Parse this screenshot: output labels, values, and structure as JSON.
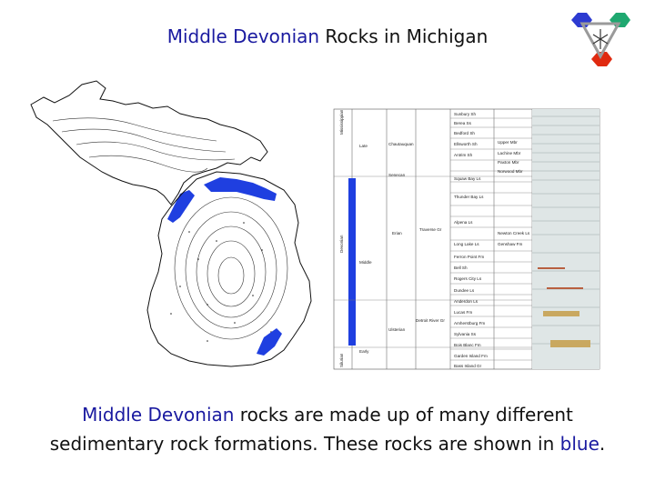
{
  "title": {
    "highlight": "Middle Devonian",
    "rest": " Rocks in Michigan"
  },
  "logo": {
    "icon": "hexagon-molecule-icon",
    "colors": [
      "#2d3bd1",
      "#1fa870",
      "#e02a10",
      "#9a9a9a"
    ]
  },
  "stratigraphy": {
    "periods": [
      "Mississippian",
      "Devonian",
      "Silurian"
    ],
    "stages": [
      "Late",
      "Middle",
      "Early"
    ],
    "series": [
      "Chautauquan",
      "Senecan",
      "Erian",
      "Ulsterian"
    ],
    "groups": [
      "Traverse Gr",
      "Detroit River Gr"
    ],
    "formations": [
      "Sunbury Sh",
      "Berea Ss",
      "Bedford Sh",
      "Ellsworth Sh",
      "Antrim Sh",
      "Upper Mbr",
      "Lachine Mbr",
      "Paxton Mbr",
      "Norwood Mbr",
      "Squaw Bay Ls",
      "Thunder Bay Ls",
      "Alpena Ls",
      "Long Lake Ls",
      "Ferron Point Fm",
      "Genshaw Fm",
      "Newton Creek Ls",
      "Rogers City Ls",
      "Bell Sh",
      "Dundee Ls",
      "Anderdon Ls",
      "Lucas Fm",
      "Amherstburg Fm",
      "Sylvania Ss",
      "Bois Blanc Fm",
      "Garden Island Fm",
      "Bass Island Gr"
    ]
  },
  "caption": {
    "line1_highlight": "Middle Devonian",
    "line1_rest": " rocks are made up of many different",
    "line2_prefix": "sedimentary rock formations.  These rocks are shown in ",
    "line2_blue": "blue",
    "line2_suffix": "."
  },
  "colors": {
    "accent": "#1a1aa0",
    "devonian_blue": "#1f3fe0"
  }
}
